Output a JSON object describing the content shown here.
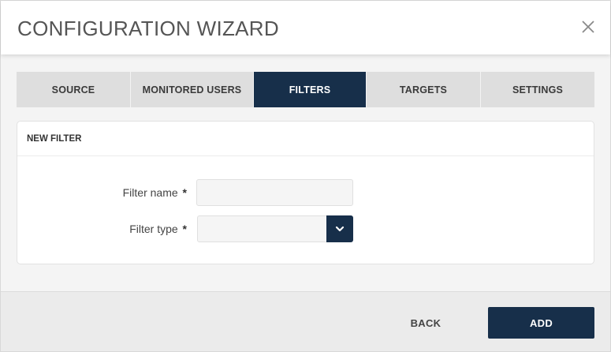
{
  "dialog": {
    "title": "CONFIGURATION WIZARD",
    "close_icon": "close-icon"
  },
  "tabs": [
    {
      "label": "SOURCE",
      "active": false
    },
    {
      "label": "MONITORED USERS",
      "active": false
    },
    {
      "label": "FILTERS",
      "active": true
    },
    {
      "label": "TARGETS",
      "active": false
    },
    {
      "label": "SETTINGS",
      "active": false
    }
  ],
  "panel": {
    "heading": "NEW FILTER",
    "fields": {
      "filter_name": {
        "label": "Filter name",
        "required_mark": "*",
        "value": "",
        "placeholder": ""
      },
      "filter_type": {
        "label": "Filter type",
        "required_mark": "*",
        "selected_value": "",
        "arrow_icon": "chevron-down-icon"
      }
    }
  },
  "footer": {
    "back_label": "BACK",
    "add_label": "ADD"
  },
  "colors": {
    "accent": "#172f4a",
    "tab_bg": "#dedede",
    "background": "#f4f4f4"
  }
}
